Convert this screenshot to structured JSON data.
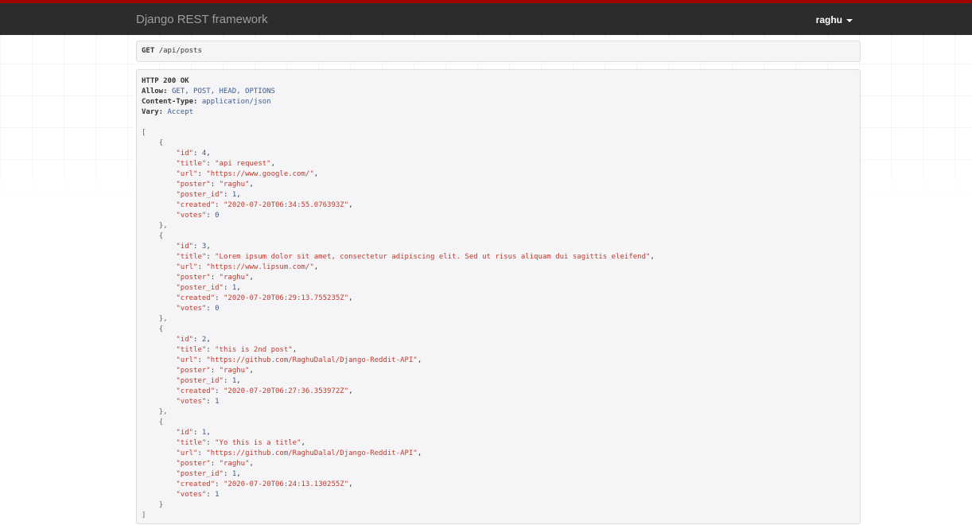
{
  "navbar": {
    "brand": "Django REST framework",
    "user": "raghu"
  },
  "request": {
    "method": "GET",
    "path": "/api/posts"
  },
  "response": {
    "status": "HTTP 200 OK",
    "headers": [
      {
        "name": "Allow:",
        "value": "GET, POST, HEAD, OPTIONS"
      },
      {
        "name": "Content-Type:",
        "value": "application/json"
      },
      {
        "name": "Vary:",
        "value": "Accept"
      }
    ],
    "posts": [
      {
        "id": 4,
        "title": "api request",
        "url": "https://www.google.com/",
        "poster": "raghu",
        "poster_id": 1,
        "created": "2020-07-20T06:34:55.076393Z",
        "votes": 0
      },
      {
        "id": 3,
        "title": "Lorem ipsum dolor sit amet, consectetur adipiscing elit. Sed ut risus aliquam dui sagittis eleifend",
        "url": "https://www.lipsum.com/",
        "poster": "raghu",
        "poster_id": 1,
        "created": "2020-07-20T06:29:13.755235Z",
        "votes": 0
      },
      {
        "id": 2,
        "title": "this is 2nd post",
        "url": "https://github.com/RaghuDalal/Django-Reddit-API",
        "poster": "raghu",
        "poster_id": 1,
        "created": "2020-07-20T06:27:36.353972Z",
        "votes": 1
      },
      {
        "id": 1,
        "title": "Yo this is a title",
        "url": "https://github.com/RaghuDalal/Django-Reddit-API",
        "poster": "raghu",
        "poster_id": 1,
        "created": "2020-07-20T06:24:13.130255Z",
        "votes": 1
      }
    ]
  }
}
